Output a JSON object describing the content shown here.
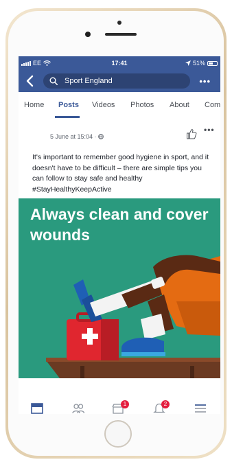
{
  "status_bar": {
    "carrier": "EE",
    "time": "17:41",
    "battery": "51%"
  },
  "header": {
    "search_value": "Sport England"
  },
  "tabs": [
    {
      "label": "Home",
      "active": false
    },
    {
      "label": "Posts",
      "active": true
    },
    {
      "label": "Videos",
      "active": false
    },
    {
      "label": "Photos",
      "active": false
    },
    {
      "label": "About",
      "active": false
    },
    {
      "label": "Com",
      "active": false
    }
  ],
  "post": {
    "date": "5 June at 15:04 ·",
    "text": "It's important to remember good hygiene in sport, and it doesn't have to be difficult – there are simple tips you can follow to stay safe and healthy #StayHealthyKeepActive",
    "image_headline": "Always clean and cover wounds"
  },
  "bottom_nav": {
    "badges": {
      "marketplace": "1",
      "notifications": "2"
    }
  },
  "icons": [
    "back-icon",
    "search-icon",
    "more-icon",
    "globe-icon",
    "like-icon",
    "news-feed-icon",
    "friends-icon",
    "marketplace-icon",
    "notifications-icon",
    "menu-icon"
  ],
  "colors": {
    "brand": "#3b5998",
    "image_bg": "#2a9a7e",
    "badge": "#e41e3f"
  }
}
